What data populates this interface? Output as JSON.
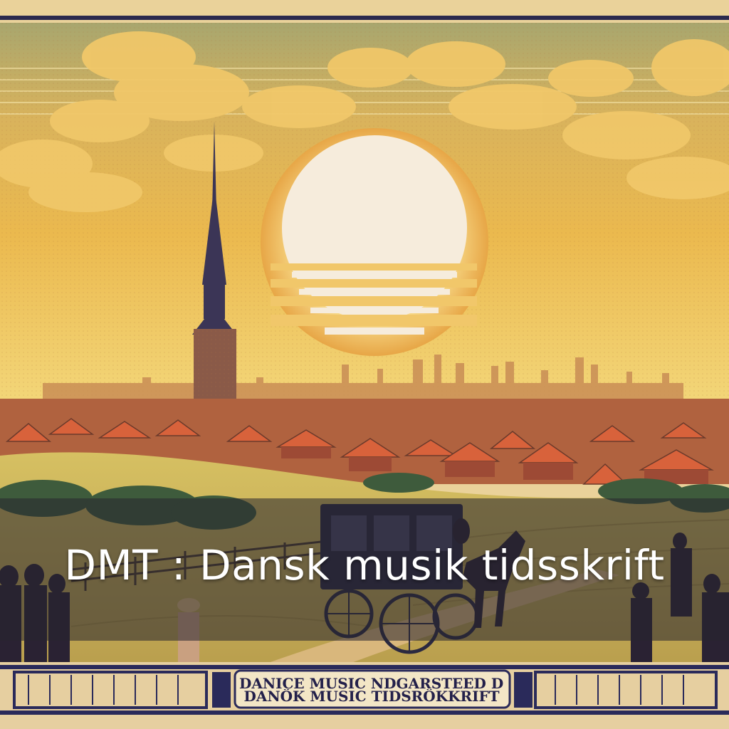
{
  "caption": {
    "title": "DMT : Dansk musik tidsskrift"
  },
  "plaque": {
    "line1": "DANICE MUSIC NDGARSTEED DK",
    "line2": "DANÖK MUSIC TIDSRÖKKRIFT"
  },
  "colors": {
    "sky": "#e9b64d",
    "sun": "#f6ecdc",
    "roofs": "#d8623b",
    "fields": "#c9b65a",
    "navy_border": "#2a2a5a",
    "caption_band": "#26242e"
  }
}
